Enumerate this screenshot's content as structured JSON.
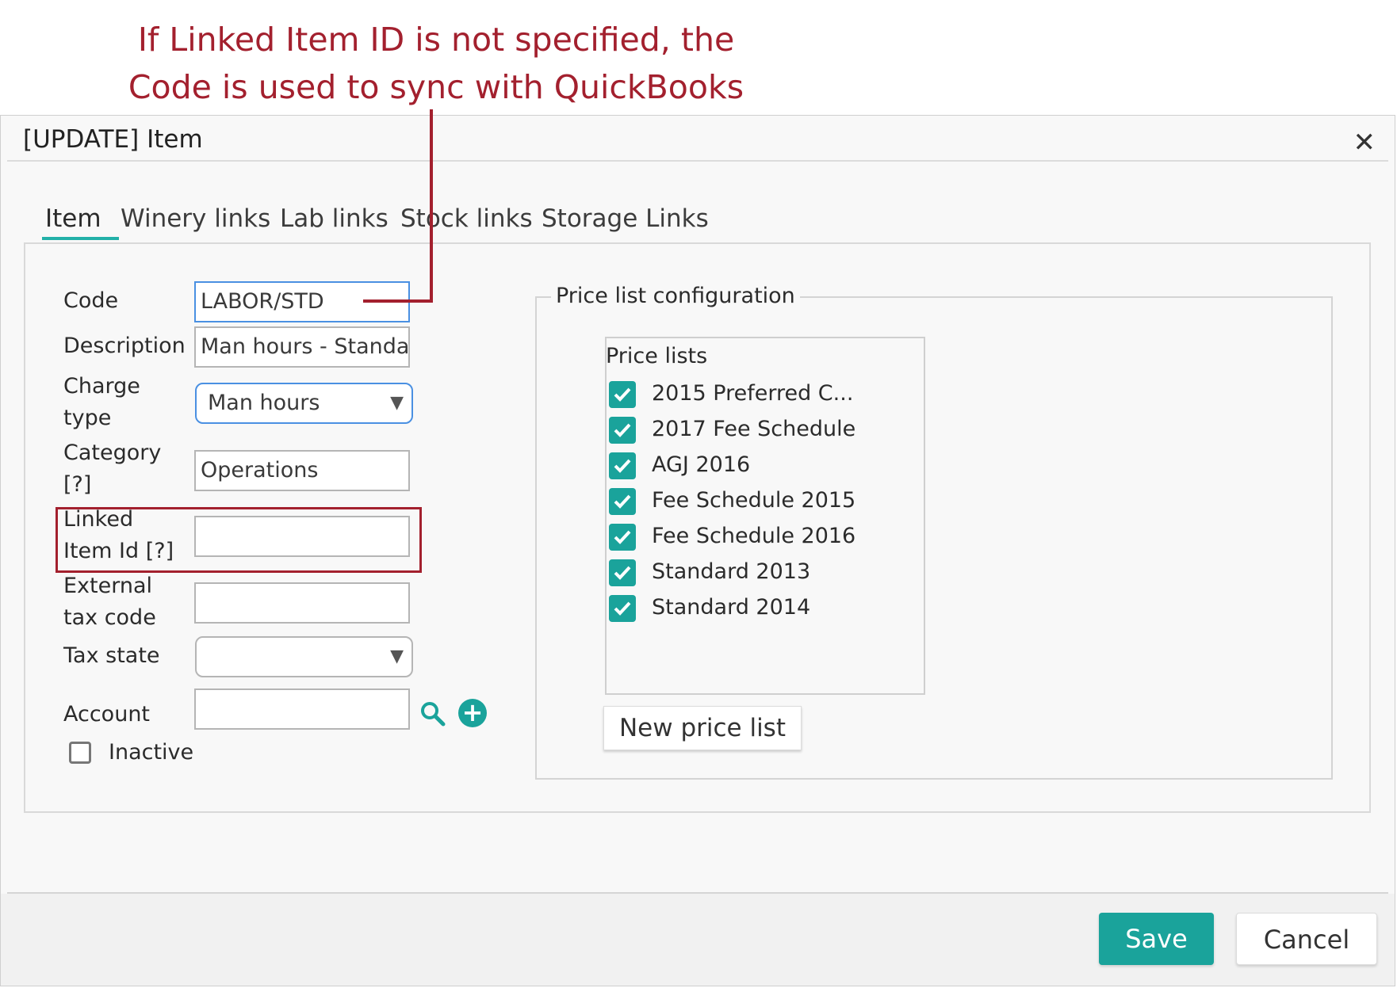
{
  "annotation": {
    "line1": "If Linked Item ID is not specified, the",
    "line2": "Code is used to sync with QuickBooks",
    "color": "#a3202e"
  },
  "dialog": {
    "title": "[UPDATE] Item",
    "close_icon": "close-icon",
    "close_glyph": "✕"
  },
  "tabs": [
    {
      "label": "Item",
      "active": true
    },
    {
      "label": "Winery links",
      "active": false
    },
    {
      "label": "Lab links",
      "active": false
    },
    {
      "label": "Stock links",
      "active": false
    },
    {
      "label": "Storage Links",
      "active": false
    }
  ],
  "form": {
    "code": {
      "label": "Code",
      "value": "LABOR/STD"
    },
    "description": {
      "label": "Description",
      "value": "Man hours - Standa"
    },
    "charge_type": {
      "label_line1": "Charge",
      "label_line2": "type",
      "value": "Man hours"
    },
    "category": {
      "label_line1": "Category",
      "label_line2": "[?]",
      "value": "Operations"
    },
    "linked_item_id": {
      "label_line1": "Linked",
      "label_line2": "Item Id [?]",
      "value": ""
    },
    "external_tax_code": {
      "label_line1": "External",
      "label_line2": "tax code",
      "value": ""
    },
    "tax_state": {
      "label": "Tax state",
      "value": ""
    },
    "account": {
      "label": "Account",
      "value": "",
      "search_icon": "search-icon",
      "add_icon": "plus-circle-icon"
    },
    "inactive": {
      "label": "Inactive",
      "checked": false
    },
    "dropdown_glyph": "▼",
    "add_glyph": "+"
  },
  "price_config": {
    "legend": "Price list configuration",
    "list_title": "Price lists",
    "items": [
      {
        "label": "2015 Preferred C...",
        "checked": true
      },
      {
        "label": "2017 Fee Schedule",
        "checked": true
      },
      {
        "label": "AGJ 2016",
        "checked": true
      },
      {
        "label": "Fee Schedule 2015",
        "checked": true
      },
      {
        "label": "Fee Schedule 2016",
        "checked": true
      },
      {
        "label": "Standard 2013",
        "checked": true
      },
      {
        "label": "Standard 2014",
        "checked": true
      }
    ],
    "new_button": "New price list"
  },
  "footer": {
    "save": "Save",
    "cancel": "Cancel"
  },
  "colors": {
    "accent": "#1aa39b",
    "highlight": "#a3202e",
    "focus": "#4a90e2"
  }
}
